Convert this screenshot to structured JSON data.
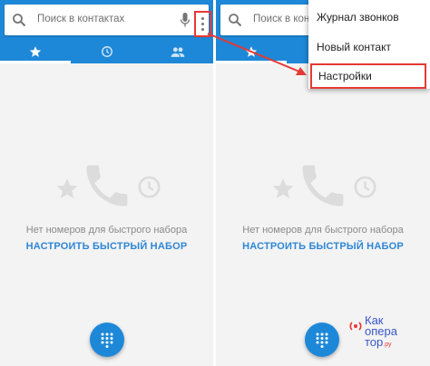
{
  "search": {
    "placeholder": "Поиск в контактах",
    "placeholder_short": "Поиск в конт"
  },
  "tabs": [
    {
      "icon": "star-icon",
      "selected": true
    },
    {
      "icon": "clock-icon",
      "selected": false
    },
    {
      "icon": "people-icon",
      "selected": false
    }
  ],
  "speed_dial": {
    "empty_text": "Нет номеров для быстрого набора",
    "setup_link": "НАСТРОИТЬ БЫСТРЫЙ НАБОР"
  },
  "overflow_menu": {
    "items": [
      "Журнал звонков",
      "Новый контакт",
      "Настройки"
    ],
    "highlighted_index": 2
  },
  "watermark": {
    "line1": "Как",
    "line2": "опера",
    "line3": "тор",
    "suffix": ".ру"
  },
  "colors": {
    "accent": "#1e88d8",
    "highlight": "#e53935",
    "link": "#2e86d6",
    "background": "#f3f3f3"
  }
}
